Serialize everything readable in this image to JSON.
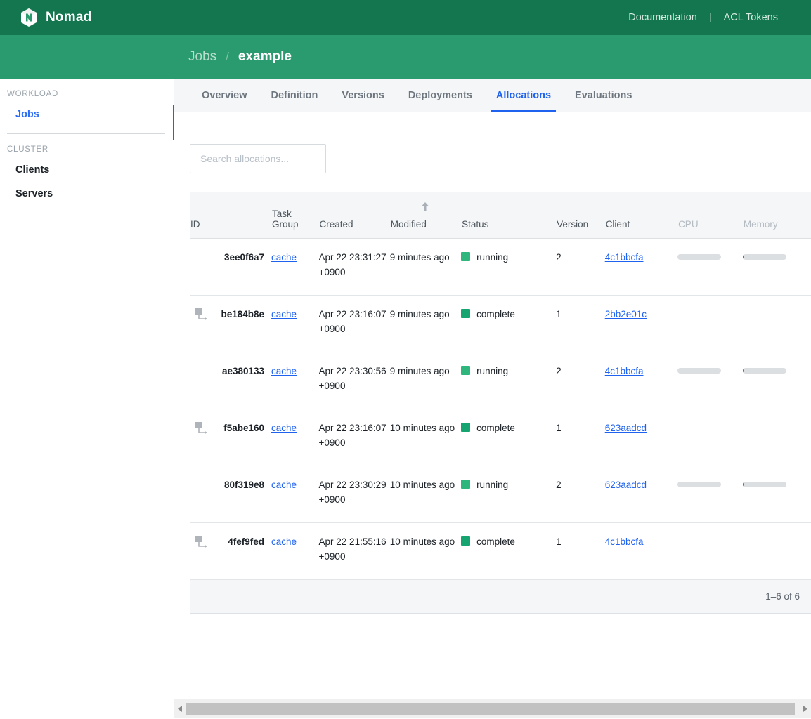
{
  "app": {
    "brand": "Nomad",
    "logo_icon": "nomad-cube-logo",
    "brand_color": "#14764f",
    "subheader_color": "#2a9b6e",
    "accent_color": "#1f62f0"
  },
  "topnav": {
    "documentation": "Documentation",
    "separator": "|",
    "acl_tokens": "ACL Tokens"
  },
  "breadcrumb": {
    "parent": "Jobs",
    "separator": "/",
    "current": "example"
  },
  "sidebar": {
    "sections": [
      {
        "title": "WORKLOAD",
        "items": [
          {
            "label": "Jobs",
            "active": true
          }
        ]
      },
      {
        "title": "CLUSTER",
        "items": [
          {
            "label": "Clients",
            "active": false
          },
          {
            "label": "Servers",
            "active": false
          }
        ]
      }
    ]
  },
  "tabs": [
    {
      "label": "Overview",
      "active": false
    },
    {
      "label": "Definition",
      "active": false
    },
    {
      "label": "Versions",
      "active": false
    },
    {
      "label": "Deployments",
      "active": false
    },
    {
      "label": "Allocations",
      "active": true
    },
    {
      "label": "Evaluations",
      "active": false
    }
  ],
  "search": {
    "value": "",
    "placeholder": "Search allocations..."
  },
  "table": {
    "columns": [
      {
        "key": "id",
        "label": "ID",
        "dim": false,
        "sorted": false
      },
      {
        "key": "group",
        "label": "Task Group",
        "dim": false,
        "sorted": false
      },
      {
        "key": "created",
        "label": "Created",
        "dim": false,
        "sorted": false
      },
      {
        "key": "modified",
        "label": "Modified",
        "dim": false,
        "sorted": true,
        "sort_direction": "asc",
        "sort_icon": "arrow-up-icon"
      },
      {
        "key": "status",
        "label": "Status",
        "dim": false,
        "sorted": false
      },
      {
        "key": "version",
        "label": "Version",
        "dim": false,
        "sorted": false
      },
      {
        "key": "client",
        "label": "Client",
        "dim": false,
        "sorted": false
      },
      {
        "key": "cpu",
        "label": "CPU",
        "dim": true,
        "sorted": false
      },
      {
        "key": "memory",
        "label": "Memory",
        "dim": true,
        "sorted": false
      }
    ],
    "rows": [
      {
        "rescheduled": false,
        "id": "3ee0f6a7",
        "task_group": "cache",
        "created": "Apr 22 23:31:27 +0900",
        "modified": "9 minutes ago",
        "status": "running",
        "status_color": "#2eb67d",
        "version": "2",
        "client": "4c1bbcfa",
        "cpu_shown": true,
        "cpu_percent": 0,
        "memory_shown": true,
        "memory_percent": 4,
        "memory_fill_color": "#c7392f"
      },
      {
        "rescheduled": true,
        "id": "be184b8e",
        "task_group": "cache",
        "created": "Apr 22 23:16:07 +0900",
        "modified": "9 minutes ago",
        "status": "complete",
        "status_color": "#16a571",
        "version": "1",
        "client": "2bb2e01c",
        "cpu_shown": false,
        "cpu_percent": 0,
        "memory_shown": false,
        "memory_percent": 0,
        "memory_fill_color": "#c7392f"
      },
      {
        "rescheduled": false,
        "id": "ae380133",
        "task_group": "cache",
        "created": "Apr 22 23:30:56 +0900",
        "modified": "9 minutes ago",
        "status": "running",
        "status_color": "#2eb67d",
        "version": "2",
        "client": "4c1bbcfa",
        "cpu_shown": true,
        "cpu_percent": 0,
        "memory_shown": true,
        "memory_percent": 4,
        "memory_fill_color": "#c7392f"
      },
      {
        "rescheduled": true,
        "id": "f5abe160",
        "task_group": "cache",
        "created": "Apr 22 23:16:07 +0900",
        "modified": "10 minutes ago",
        "status": "complete",
        "status_color": "#16a571",
        "version": "1",
        "client": "623aadcd",
        "cpu_shown": false,
        "cpu_percent": 0,
        "memory_shown": false,
        "memory_percent": 0,
        "memory_fill_color": "#c7392f"
      },
      {
        "rescheduled": false,
        "id": "80f319e8",
        "task_group": "cache",
        "created": "Apr 22 23:30:29 +0900",
        "modified": "10 minutes ago",
        "status": "running",
        "status_color": "#2eb67d",
        "version": "2",
        "client": "623aadcd",
        "cpu_shown": true,
        "cpu_percent": 0,
        "memory_shown": true,
        "memory_percent": 4,
        "memory_fill_color": "#c7392f"
      },
      {
        "rescheduled": true,
        "id": "4fef9fed",
        "task_group": "cache",
        "created": "Apr 22 21:55:16 +0900",
        "modified": "10 minutes ago",
        "status": "complete",
        "status_color": "#16a571",
        "version": "1",
        "client": "4c1bbcfa",
        "cpu_shown": false,
        "cpu_percent": 0,
        "memory_shown": false,
        "memory_percent": 0,
        "memory_fill_color": "#c7392f"
      }
    ],
    "footer": {
      "range": "1–6 of 6"
    }
  },
  "scrollbar": {
    "left_arrow_icon": "caret-left-icon",
    "right_arrow_icon": "caret-right-icon"
  }
}
